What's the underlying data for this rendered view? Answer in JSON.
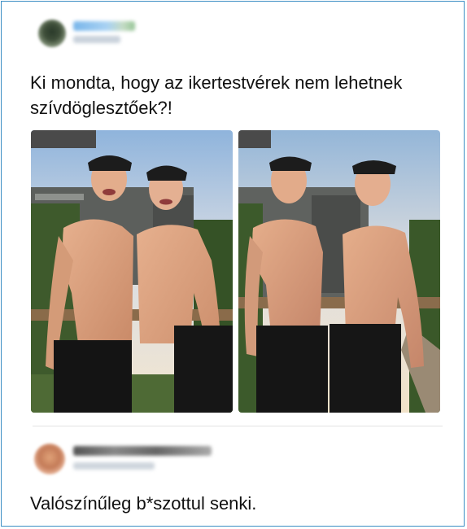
{
  "post": {
    "text": "Ki mondta, hogy az ikertestvérek nem lehetnek szívdöglesztőek?!",
    "photos": [
      {
        "alt": "photo-1"
      },
      {
        "alt": "photo-2"
      }
    ]
  },
  "reply": {
    "text": "Valószínűleg b*szottul senki."
  },
  "colors": {
    "frame_border": "#3c8fc4",
    "text": "#111111",
    "divider": "#e3e3e3"
  }
}
